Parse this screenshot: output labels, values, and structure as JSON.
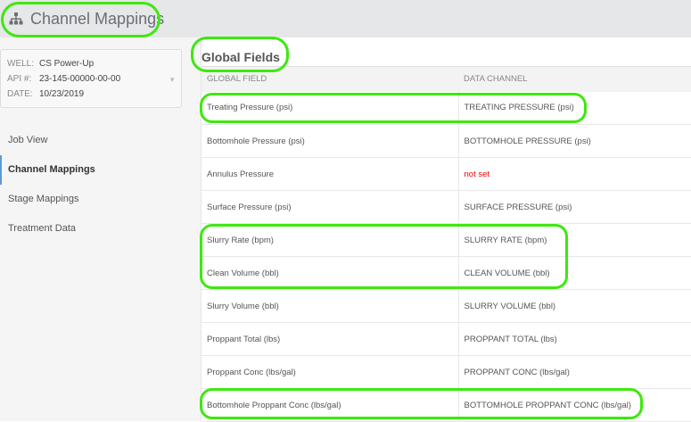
{
  "header": {
    "title": "Channel Mappings",
    "icon": "sitemap-icon"
  },
  "info": {
    "well_label": "WELL:",
    "well": "CS Power-Up",
    "api_label": "API #:",
    "api": "23-145-00000-00-00",
    "date_label": "DATE:",
    "date": "10/23/2019"
  },
  "nav": [
    {
      "label": "Job View"
    },
    {
      "label": "Channel Mappings",
      "active": true
    },
    {
      "label": "Stage Mappings"
    },
    {
      "label": "Treatment Data"
    }
  ],
  "section_title": "Global Fields",
  "table": {
    "headers": [
      "GLOBAL FIELD",
      "DATA CHANNEL"
    ],
    "rows": [
      [
        "Treating Pressure (psi)",
        "TREATING PRESSURE (psi)"
      ],
      [
        "Bottomhole Pressure (psi)",
        "BOTTOMHOLE PRESSURE (psi)"
      ],
      [
        "Annulus Pressure",
        "not set"
      ],
      [
        "Surface Pressure (psi)",
        "SURFACE PRESSURE (psi)"
      ],
      [
        "Slurry Rate (bpm)",
        "SLURRY RATE (bpm)"
      ],
      [
        "Clean Volume (bbl)",
        "CLEAN VOLUME (bbl)"
      ],
      [
        "Slurry Volume (bbl)",
        "SLURRY VOLUME (bbl)"
      ],
      [
        "Proppant Total (lbs)",
        "PROPPANT TOTAL (lbs)"
      ],
      [
        "Proppant Conc (lbs/gal)",
        "PROPPANT CONC (lbs/gal)"
      ],
      [
        "Bottomhole Proppant Conc (lbs/gal)",
        "BOTTOMHOLE PROPPANT CONC (lbs/gal)"
      ]
    ]
  },
  "colors": {
    "highlight": "#3ee80e",
    "unset": "#ee0000",
    "accent": "#5b9bd5"
  }
}
